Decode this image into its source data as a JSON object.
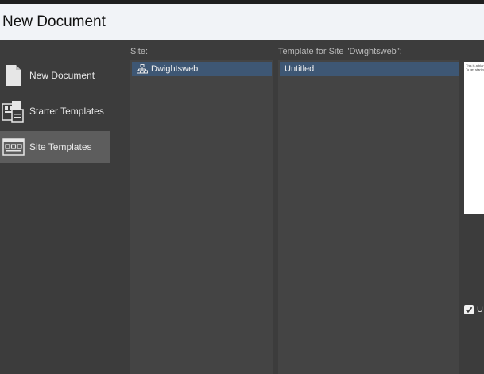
{
  "window": {
    "title": "New Document"
  },
  "categories": [
    {
      "label": "New Document",
      "icon": "blank-document-icon",
      "selected": false
    },
    {
      "label": "Starter Templates",
      "icon": "starter-templates-icon",
      "selected": false
    },
    {
      "label": "Site Templates",
      "icon": "site-templates-icon",
      "selected": true
    }
  ],
  "site_column": {
    "header": "Site:",
    "items": [
      {
        "label": "Dwightsweb",
        "icon": "site-icon",
        "selected": true
      }
    ]
  },
  "template_column": {
    "header": "Template for Site \"Dwightsweb\":",
    "items": [
      {
        "label": "Untitled",
        "selected": true
      }
    ]
  },
  "preview": {
    "lines": [
      "This is a blank",
      "To get started"
    ]
  },
  "update_checkbox": {
    "checked": true,
    "label": "U"
  },
  "colors": {
    "accent_selection": "#3e5774",
    "panel_bg": "#444444",
    "dialog_bg": "#3c3c3c",
    "titlebar_bg": "#f1f3f7"
  }
}
